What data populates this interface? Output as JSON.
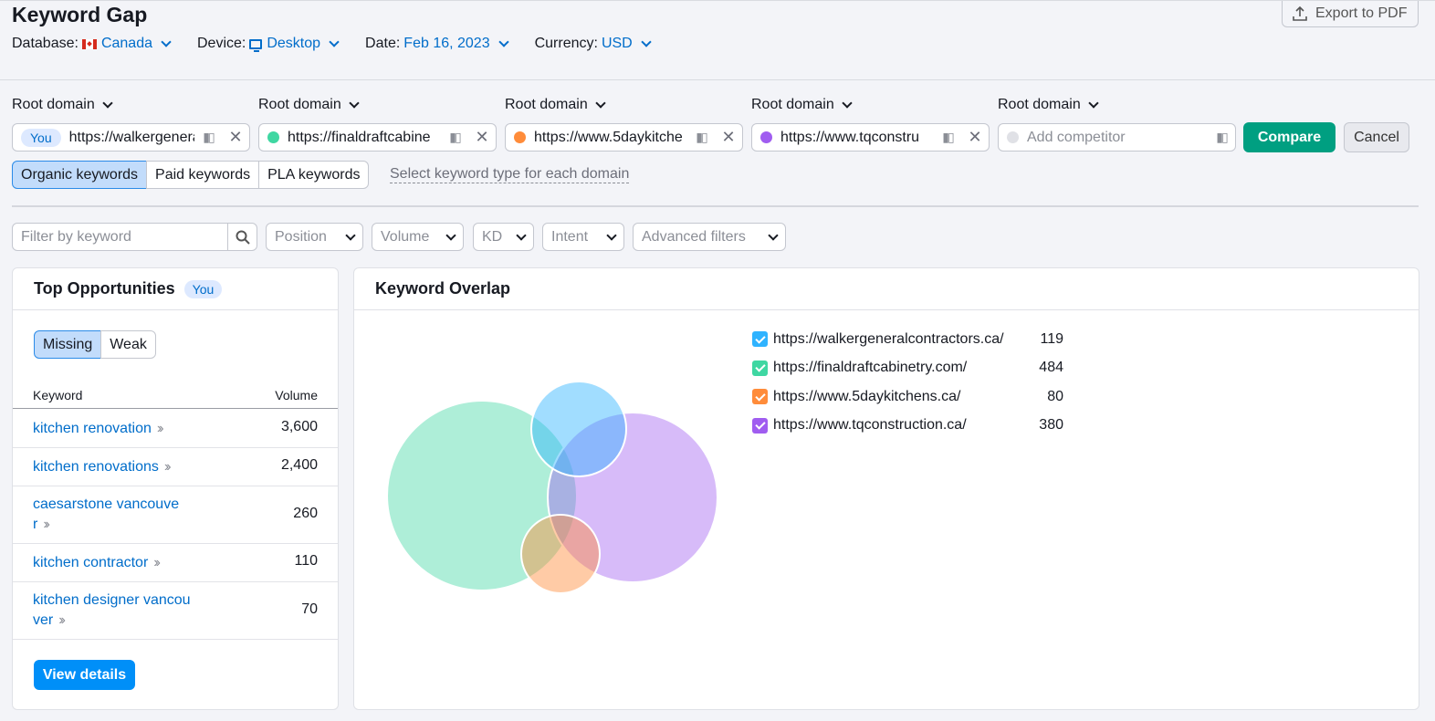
{
  "header": {
    "title": "Keyword Gap",
    "export_label": "Export to PDF",
    "filters": [
      {
        "label": "Database:",
        "value": "Canada"
      },
      {
        "label": "Device:",
        "value": "Desktop"
      },
      {
        "label": "Date:",
        "value": "Feb 16, 2023"
      },
      {
        "label": "Currency:",
        "value": "USD"
      }
    ]
  },
  "domains": {
    "label": "Root domain",
    "you_label": "You",
    "items": [
      {
        "url": "https://walkergeneral",
        "color": "#2fb3ff"
      },
      {
        "url": "https://finaldraftcabine",
        "color": "#3fd7a2"
      },
      {
        "url": "https://www.5daykitche",
        "color": "#ff8c3a"
      },
      {
        "url": "https://www.tqconstru",
        "color": "#a05df0"
      },
      {
        "placeholder": "Add competitor",
        "color": "#e0e1e6"
      }
    ],
    "compare_label": "Compare",
    "cancel_label": "Cancel"
  },
  "keyword_types": {
    "tabs": [
      "Organic keywords",
      "Paid keywords",
      "PLA keywords"
    ],
    "active": "Organic keywords",
    "hint": "Select keyword type for each domain"
  },
  "filterbar": {
    "search_placeholder": "Filter by keyword",
    "dropdowns": [
      "Position",
      "Volume",
      "KD",
      "Intent",
      "Advanced filters"
    ]
  },
  "opportunities": {
    "title": "Top Opportunities",
    "badge": "You",
    "tabs": [
      "Missing",
      "Weak"
    ],
    "col_keyword": "Keyword",
    "col_volume": "Volume",
    "rows": [
      {
        "keyword": "kitchen renovation",
        "volume": "3,600"
      },
      {
        "keyword": "kitchen renovations",
        "volume": "2,400"
      },
      {
        "keyword": "caesarstone vancouver",
        "volume": "260"
      },
      {
        "keyword": "kitchen contractor",
        "volume": "110"
      },
      {
        "keyword": "kitchen designer vancouver",
        "volume": "70"
      }
    ],
    "view_details": "View details"
  },
  "overlap": {
    "title": "Keyword Overlap",
    "legend": [
      {
        "url": "https://walkergeneralcontractors.ca/",
        "count": "119",
        "color": "#2fb3ff"
      },
      {
        "url": "https://finaldraftcabinetry.com/",
        "count": "484",
        "color": "#3fd7a2"
      },
      {
        "url": "https://www.5daykitchens.ca/",
        "count": "80",
        "color": "#ff8c3a"
      },
      {
        "url": "https://www.tqconstruction.ca/",
        "count": "380",
        "color": "#a05df0"
      }
    ]
  }
}
